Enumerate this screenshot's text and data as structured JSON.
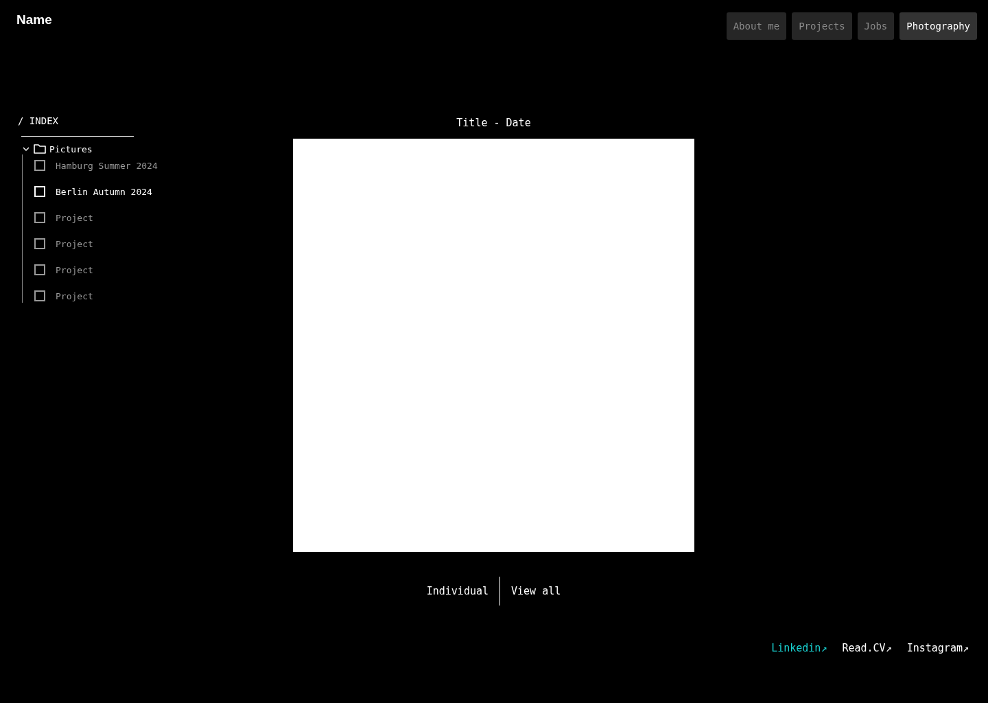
{
  "site_name": "Name",
  "nav": [
    {
      "label": "About me",
      "selected": false
    },
    {
      "label": "Projects",
      "selected": false
    },
    {
      "label": "Jobs",
      "selected": false
    },
    {
      "label": "Photography",
      "selected": true
    }
  ],
  "index": {
    "heading": "/ INDEX",
    "folder": {
      "label": "Pictures",
      "expanded": true,
      "children": [
        {
          "label": "Hamburg Summer 2024",
          "selected": false
        },
        {
          "label": "Berlin Autumn 2024",
          "selected": true
        },
        {
          "label": "Project",
          "selected": false
        },
        {
          "label": "Project",
          "selected": false
        },
        {
          "label": "Project",
          "selected": false
        },
        {
          "label": "Project",
          "selected": false
        }
      ]
    }
  },
  "viewer": {
    "title": "Title - Date",
    "modes": [
      {
        "label": "Individual"
      },
      {
        "label": "View all"
      }
    ]
  },
  "footer_links": [
    {
      "label": "Linkedin↗",
      "highlighted": true
    },
    {
      "label": "Read.CV↗",
      "highlighted": false
    },
    {
      "label": "Instagram↗",
      "highlighted": false
    }
  ]
}
